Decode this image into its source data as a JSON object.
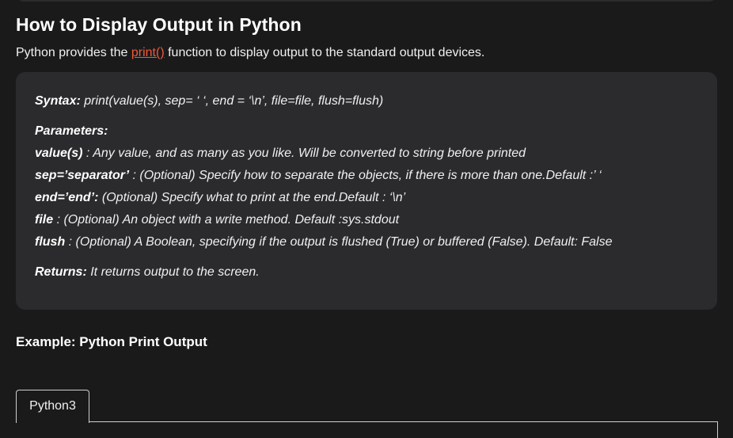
{
  "heading": "How to Display Output in Python",
  "intro": {
    "before": "Python provides the ",
    "link": "print()",
    "after": " function to display output to the standard output devices."
  },
  "syntax_box": {
    "syntax_label": "Syntax:",
    "syntax_text": " print(value(s), sep= ‘ ‘, end = ‘\\n’, file=file, flush=flush)",
    "parameters_label": "Parameters:",
    "params": [
      {
        "name": "value(s)",
        "desc": " : Any value, and as many as you like. Will be converted to string before printed"
      },
      {
        "name": "sep=’separator’",
        "desc": " : (Optional) Specify how to separate the objects, if there is more than one.Default :’ ‘"
      },
      {
        "name": "end=’end’:",
        "desc": " (Optional) Specify what to print at the end.Default : ‘\\n’"
      },
      {
        "name": "file",
        "desc": " : (Optional) An object with a write method. Default :sys.stdout"
      },
      {
        "name": "flush",
        "desc": " : (Optional) A Boolean, specifying if the output is flushed (True) or buffered (False). Default: False"
      }
    ],
    "returns_label": "Returns:",
    "returns_text": " It returns output to the screen."
  },
  "example_title": "Example: Python Print Output",
  "code_tabs": {
    "active": "Python3"
  },
  "colors": {
    "background": "#1a1a1b",
    "box": "#2b2b2e",
    "link": "#ee5a3a"
  }
}
